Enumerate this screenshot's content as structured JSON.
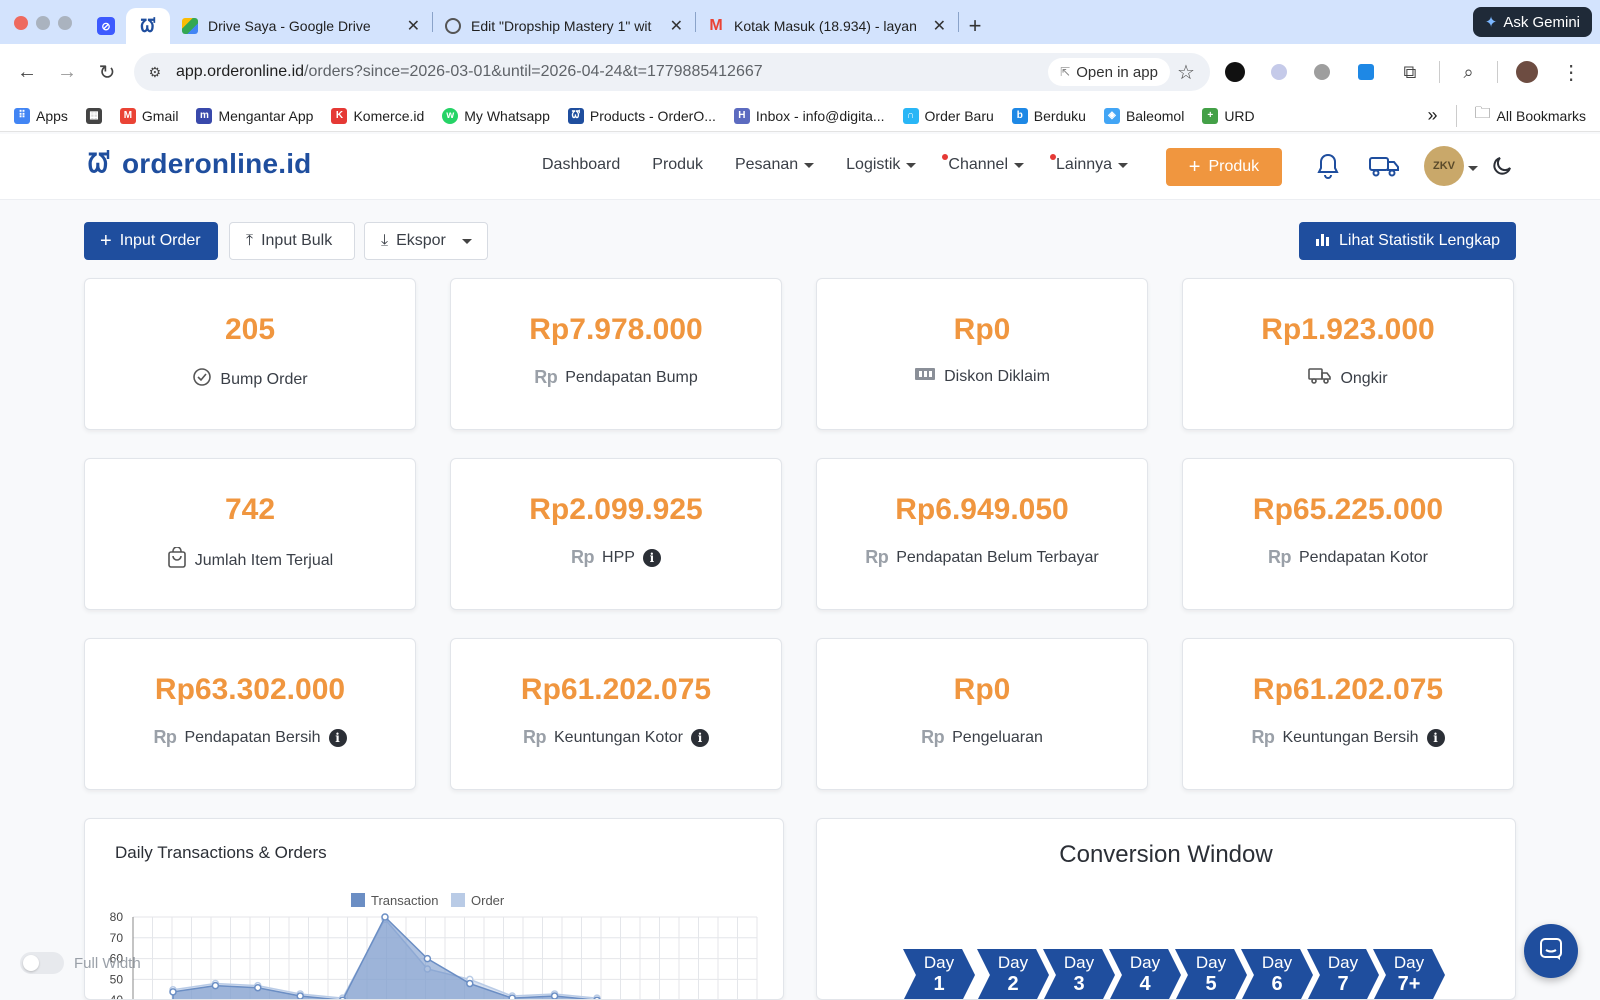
{
  "browser": {
    "tabs": [
      {
        "title": "Drive Saya - Google Drive",
        "close": "✕"
      },
      {
        "title": "Edit \"Dropship Mastery 1\" wit",
        "close": "✕"
      },
      {
        "title": "Kotak Masuk (18.934) - layan",
        "close": "✕"
      }
    ],
    "new_tab": "+",
    "gemini_label": "Ask Gemini",
    "url_host": "app.orderonline.id",
    "url_path": "/orders?since=2026-03-01&until=2026-04-24&t=1779885412667",
    "open_in_app": "Open in app",
    "bookmarks": [
      {
        "label": "Apps",
        "color": "#4285f4"
      },
      {
        "label": "",
        "color": "#444444"
      },
      {
        "label": "Gmail",
        "color": "#ea4335"
      },
      {
        "label": "Mengantar App",
        "color": "#3949ab"
      },
      {
        "label": "Komerce.id",
        "color": "#e53935"
      },
      {
        "label": "My Whatsapp",
        "color": "#25d366"
      },
      {
        "label": "Products - OrderO...",
        "color": "#1f4e9e"
      },
      {
        "label": "Inbox - info@digita...",
        "color": "#5c6bc0"
      },
      {
        "label": "Order Baru",
        "color": "#29b6f6"
      },
      {
        "label": "Berduku",
        "color": "#1e88e5"
      },
      {
        "label": "Baleomol",
        "color": "#42a5f5"
      },
      {
        "label": "URD",
        "color": "#43a047"
      }
    ],
    "bookmarks_more": "»",
    "all_bookmarks": "All Bookmarks"
  },
  "app": {
    "logo_text": "orderonline.id",
    "nav": [
      {
        "label": "Dashboard",
        "dropdown": false,
        "dot": false
      },
      {
        "label": "Produk",
        "dropdown": false,
        "dot": false
      },
      {
        "label": "Pesanan",
        "dropdown": true,
        "dot": false
      },
      {
        "label": "Logistik",
        "dropdown": true,
        "dot": false
      },
      {
        "label": "Channel",
        "dropdown": true,
        "dot": true
      },
      {
        "label": "Lainnya",
        "dropdown": true,
        "dot": true
      }
    ],
    "add_product_label": "Produk",
    "avatar_text": "ZKV",
    "accent": "#f0963f",
    "primary": "#1f4e9e"
  },
  "actions": {
    "input_order": "Input Order",
    "input_bulk": "Input Bulk",
    "export": "Ekspor",
    "stats": "Lihat Statistik Lengkap"
  },
  "stats": [
    {
      "value": "205",
      "label": "Bump Order",
      "icon": "check-circle-icon",
      "info": false
    },
    {
      "value": "Rp7.978.000",
      "label": "Pendapatan Bump",
      "icon": "rp-icon",
      "info": false
    },
    {
      "value": "Rp0",
      "label": "Diskon Diklaim",
      "icon": "ticket-icon",
      "info": false
    },
    {
      "value": "Rp1.923.000",
      "label": "Ongkir",
      "icon": "truck-icon",
      "info": false
    },
    {
      "value": "742",
      "label": "Jumlah Item Terjual",
      "icon": "shopping-bag-icon",
      "info": false
    },
    {
      "value": "Rp2.099.925",
      "label": "HPP",
      "icon": "rp-icon",
      "info": true
    },
    {
      "value": "Rp6.949.050",
      "label": "Pendapatan Belum Terbayar",
      "icon": "rp-icon",
      "info": false
    },
    {
      "value": "Rp65.225.000",
      "label": "Pendapatan Kotor",
      "icon": "rp-icon",
      "info": false
    },
    {
      "value": "Rp63.302.000",
      "label": "Pendapatan Bersih",
      "icon": "rp-icon",
      "info": true
    },
    {
      "value": "Rp61.202.075",
      "label": "Keuntungan Kotor",
      "icon": "rp-icon",
      "info": true
    },
    {
      "value": "Rp0",
      "label": "Pengeluaran",
      "icon": "rp-icon",
      "info": false
    },
    {
      "value": "Rp61.202.075",
      "label": "Keuntungan Bersih",
      "icon": "rp-icon",
      "info": true
    }
  ],
  "rp_symbol": "Rp",
  "info_symbol": "i",
  "daily_chart": {
    "title": "Daily Transactions & Orders"
  },
  "chart_data": {
    "type": "area",
    "title": "Daily Transactions & Orders",
    "legend": [
      "Transaction",
      "Order"
    ],
    "legend_position": "top-center",
    "y_ticks_visible": [
      80,
      70,
      60,
      50,
      40
    ],
    "ylim": [
      40,
      80
    ],
    "grid": true,
    "series": [
      {
        "name": "Transaction",
        "color": "#6b8ec4",
        "values": [
          44,
          47,
          46,
          42,
          40,
          80,
          60,
          48,
          41,
          42,
          40
        ]
      },
      {
        "name": "Order",
        "color": "#b9cbe6",
        "values": [
          45,
          48,
          47,
          43,
          41,
          79,
          55,
          50,
          42,
          43,
          41
        ]
      }
    ]
  },
  "conversion": {
    "title": "Conversion Window",
    "days": [
      {
        "label": "Day",
        "num": "1"
      },
      {
        "label": "Day",
        "num": "2"
      },
      {
        "label": "Day",
        "num": "3"
      },
      {
        "label": "Day",
        "num": "4"
      },
      {
        "label": "Day",
        "num": "5"
      },
      {
        "label": "Day",
        "num": "6"
      },
      {
        "label": "Day",
        "num": "7"
      },
      {
        "label": "Day",
        "num": "7+"
      }
    ]
  },
  "full_width_label": "Full Width"
}
